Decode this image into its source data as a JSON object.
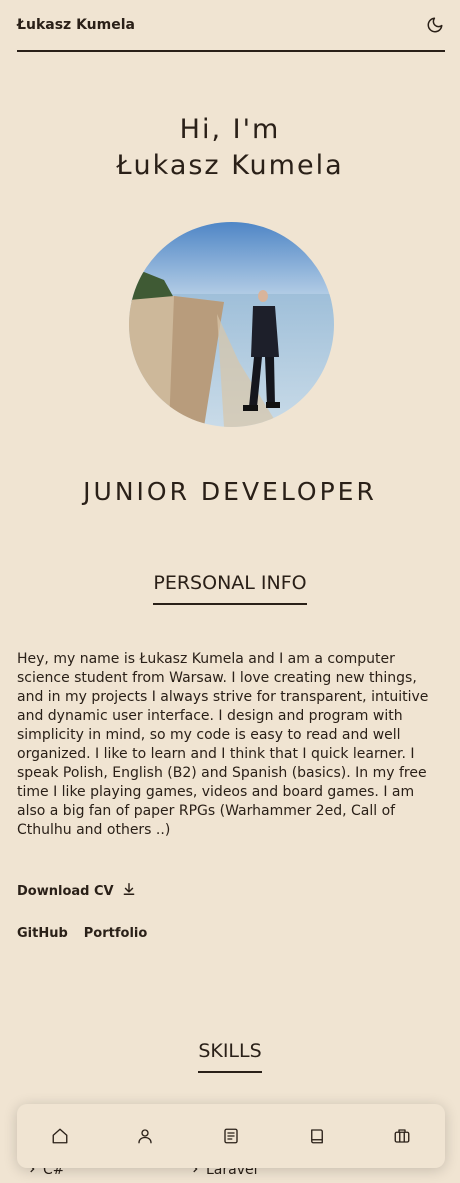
{
  "header": {
    "brand": "Łukasz Kumela",
    "theme_icon": "moon-icon"
  },
  "hero": {
    "greeting": "Hi, I'm",
    "name": "Łukasz Kumela",
    "role": "JUNIOR DEVELOPER"
  },
  "personal_info": {
    "title": "PERSONAL INFO",
    "bio": "Hey, my name is Łukasz Kumela and I am a computer science student from Warsaw. I love creating new things, and in my projects I always strive for transparent, intuitive and dynamic user interface. I design and program with simplicity in mind, so my code is easy to read and well organized. I like to learn and I think that I quick learner. I speak Polish, English (B2) and Spanish (basics). In my free time I like playing games, videos and board games. I am also a big fan of paper RPGs (Warhammer 2ed, Call of Cthulhu and others ..)",
    "download_label": "Download CV",
    "links": [
      "GitHub",
      "Portfolio"
    ]
  },
  "skills": {
    "title": "SKILLS",
    "items": [
      "C#",
      "Laravel"
    ]
  },
  "bottom_nav": {
    "icons": [
      "home-icon",
      "user-icon",
      "document-icon",
      "book-icon",
      "briefcase-icon"
    ]
  },
  "colors": {
    "background": "#f0e4d2",
    "text": "#2a2018"
  }
}
